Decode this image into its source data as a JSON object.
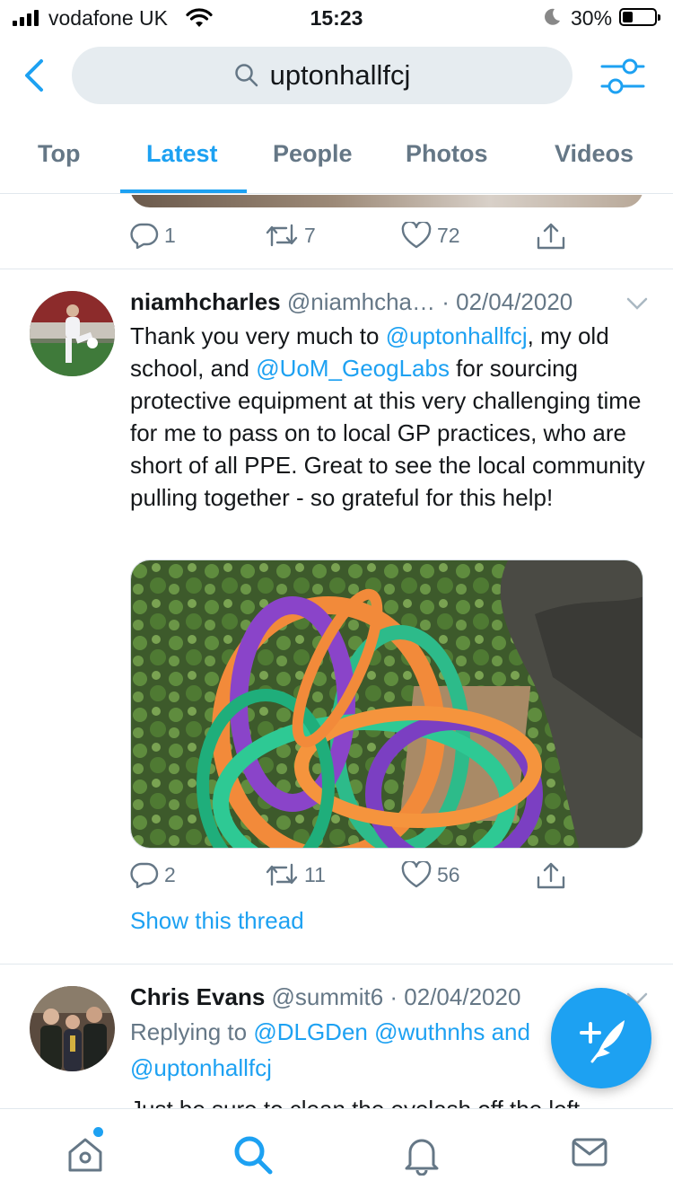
{
  "status_bar": {
    "carrier": "vodafone UK",
    "time": "15:23",
    "battery": "30%",
    "battery_level": 0.3
  },
  "search": {
    "query": "uptonhallfcj"
  },
  "tabs": [
    {
      "label": "Top",
      "active": false
    },
    {
      "label": "Latest",
      "active": true
    },
    {
      "label": "People",
      "active": false
    },
    {
      "label": "Photos",
      "active": false
    },
    {
      "label": "Videos",
      "active": false
    }
  ],
  "previous_tweet": {
    "replies": "1",
    "retweets": "7",
    "likes": "72"
  },
  "tweet1": {
    "name": "niamhcharles",
    "handle": "@niamhcha…",
    "date": "· 02/04/2020",
    "text_1": "Thank you very much to ",
    "mention_1": "@uptonhallfcj",
    "text_2": ", my old school, and ",
    "mention_2": "@UoM_GeogLabs",
    "text_3": " for sourcing protective equipment at this very challenging time for me to pass on to local GP practices, who are short of all PPE. Great to see the local community pulling together - so grateful for this help!",
    "replies": "2",
    "retweets": "11",
    "likes": "56",
    "show_thread": "Show this thread"
  },
  "tweet2": {
    "name": "Chris Evans",
    "handle": "@summit6",
    "date": "· 02/04/2020",
    "replying_prefix": "Replying to ",
    "reply_mention_1": "@DLGDen",
    "reply_mention_2": "@wuthnhs",
    "reply_and": " and",
    "reply_mention_3": "@uptonhallfcj",
    "text_partial": "Just be sure to clean the eyelash off the left"
  },
  "colors": {
    "accent": "#1da1f2",
    "muted": "#657786",
    "divider": "#e1e8ed"
  },
  "icons": [
    "back-arrow-icon",
    "search-icon",
    "filter-icon",
    "reply-icon",
    "retweet-icon",
    "like-icon",
    "share-icon",
    "chevron-down-icon",
    "compose-icon",
    "home-icon",
    "explore-icon",
    "notifications-icon",
    "messages-icon"
  ]
}
